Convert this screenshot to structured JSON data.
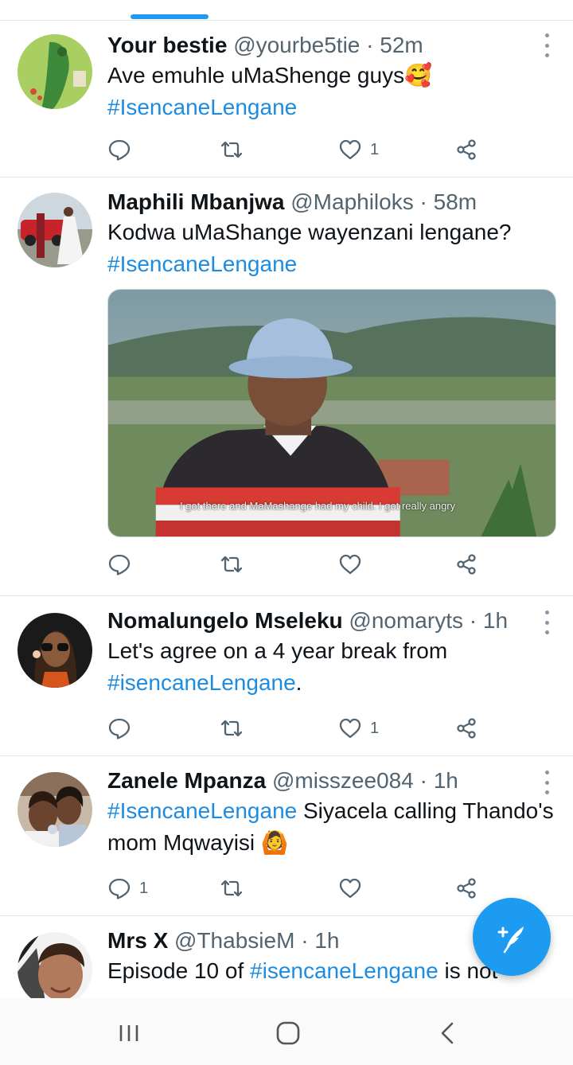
{
  "tweets": [
    {
      "name": "Your bestie",
      "handle": "@yourbe5tie",
      "time": "52m",
      "text_plain": "Ave emuhle uMaShenge guys🥰",
      "hashtag": "#IsencaneLengane",
      "reply_count": "",
      "like_count": "1"
    },
    {
      "name": "Maphili Mbanjwa",
      "handle": "@Maphiloks",
      "time": "58m",
      "text_plain": "Kodwa uMaShange wayenzani lengane?",
      "hashtag": "#IsencaneLengane",
      "media_caption": "I got there and MaMashange had my child. I got really angry",
      "reply_count": "",
      "like_count": ""
    },
    {
      "name": "Nomalungelo Mseleku",
      "handle": "@nomaryts",
      "time": "1h",
      "text_plain": "Let's agree on a 4 year break from",
      "hashtag": "#isencaneLengane",
      "text_after": ".",
      "reply_count": "",
      "like_count": "1"
    },
    {
      "name": "Zanele Mpanza",
      "handle": "@misszee084",
      "time": "1h",
      "hashtag": "#IsencaneLengane",
      "text_after": " Siyacela calling Thando's mom Mqwayisi 🙆",
      "reply_count": "1",
      "like_count": ""
    },
    {
      "name": "Mrs X",
      "handle": "@ThabsieM",
      "time": "1h",
      "text_plain": "Episode 10 of",
      "hashtag": "#isencaneLengane",
      "text_after": " is not"
    }
  ],
  "separator": "·",
  "colors": {
    "accent": "#1d9bf0",
    "hashtag": "#1d8ce0",
    "secondary_text": "#536471"
  },
  "icons": {
    "reply": "reply-icon",
    "retweet": "retweet-icon",
    "like": "heart-icon",
    "share": "share-icon",
    "more": "more-vertical-icon",
    "compose": "compose-tweet-icon",
    "nav_recents": "recent-apps-icon",
    "nav_home": "home-icon",
    "nav_back": "back-icon"
  }
}
